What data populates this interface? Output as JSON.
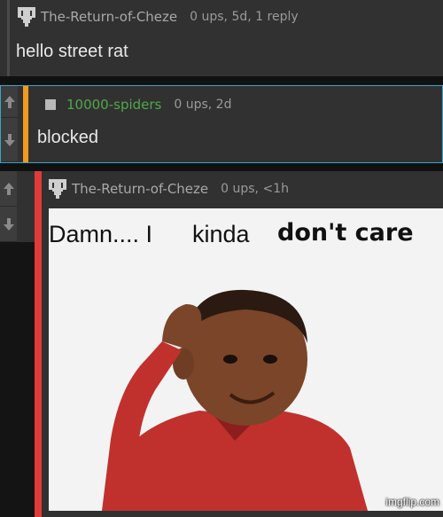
{
  "comments": [
    {
      "username": "The-Return-of-Cheze",
      "stats": "0 ups, 5d, 1 reply",
      "body": "hello street rat"
    },
    {
      "username": "10000-spiders",
      "stats": "0 ups, 2d",
      "body": "blocked"
    },
    {
      "username": "The-Return-of-Cheze",
      "stats": "0 ups, <1h",
      "meme": {
        "caption_left": "Damn.... I",
        "caption_middle": "kinda",
        "caption_right": "don't care",
        "watermark": "imgflip.com"
      }
    }
  ],
  "icons": {
    "upvote": "up-arrow-icon",
    "downvote": "down-arrow-icon",
    "avatar": "pixel-avatar-icon",
    "square": "square-icon"
  },
  "colors": {
    "username_default": "#a9a9a9",
    "username_green": "#4fa84a",
    "accent_orange": "#f09a1e",
    "accent_red": "#e23a3a",
    "accent_blue": "#3aa6c8"
  }
}
